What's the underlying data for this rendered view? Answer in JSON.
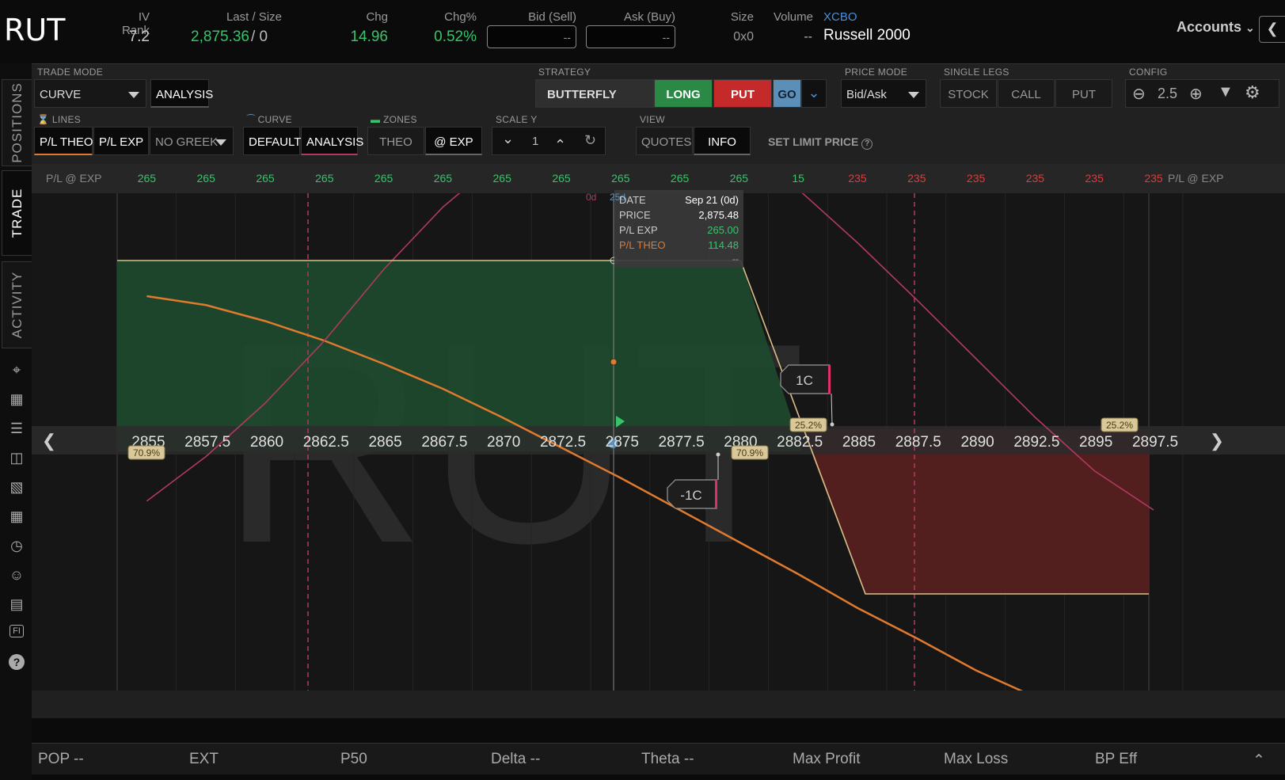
{
  "header": {
    "symbol": "RUT",
    "iv_rank_label": "IV Rank",
    "iv_rank": "7.2",
    "last_label": "Last / Size",
    "last": "2,875.36",
    "last_size": "/ 0",
    "chg_label": "Chg",
    "chg": "14.96",
    "chgpct_label": "Chg%",
    "chgpct": "0.52%",
    "bid_label": "Bid (Sell)",
    "bid": "--",
    "ask_label": "Ask (Buy)",
    "ask": "--",
    "size_label": "Size",
    "size": "0x0",
    "volume_label": "Volume",
    "volume": "--",
    "exchange": "XCBO",
    "name": "Russell 2000",
    "accounts": "Accounts"
  },
  "sidebar": {
    "tabs": [
      "POSITIONS",
      "TRADE",
      "ACTIVITY"
    ]
  },
  "toolbar": {
    "trade_mode_label": "TRADE MODE",
    "trade_mode": "CURVE",
    "analysis": "ANALYSIS",
    "strategy_label": "STRATEGY",
    "strategy": "BUTTERFLY",
    "long": "LONG",
    "put": "PUT",
    "go": "GO",
    "price_mode_label": "PRICE MODE",
    "price_mode": "Bid/Ask",
    "single_legs_label": "SINGLE LEGS",
    "legs": [
      "STOCK",
      "CALL",
      "PUT"
    ],
    "config_label": "CONFIG",
    "zoom": "2.5",
    "lines_label": "LINES",
    "lines": [
      "P/L THEO",
      "P/L EXP"
    ],
    "greek": "NO GREEK",
    "curve_label": "CURVE",
    "curve": [
      "DEFAULT",
      "ANALYSIS"
    ],
    "zones_label": "ZONES",
    "zones": [
      "THEO",
      "@ EXP"
    ],
    "scale_label": "SCALE Y",
    "scale": "1",
    "view_label": "VIEW",
    "view": [
      "QUOTES",
      "INFO"
    ],
    "limit": "SET LIMIT PRICE"
  },
  "pl_row": {
    "label": "P/L @ EXP",
    "values": [
      "265",
      "265",
      "265",
      "265",
      "265",
      "265",
      "265",
      "265",
      "265",
      "265",
      "265",
      "15",
      "235",
      "235",
      "235",
      "235",
      "235",
      "235"
    ],
    "colors": [
      "g",
      "g",
      "g",
      "g",
      "g",
      "g",
      "g",
      "g",
      "g",
      "g",
      "g",
      "g",
      "r",
      "r",
      "r",
      "r",
      "r",
      "r"
    ]
  },
  "chart_data": {
    "type": "line",
    "watermark": "RUT",
    "x_ticks": [
      "2855",
      "2857.5",
      "2860",
      "2862.5",
      "2865",
      "2867.5",
      "2870",
      "2872.5",
      "2875",
      "2877.5",
      "2880",
      "2882.5",
      "2885",
      "2887.5",
      "2890",
      "2892.5",
      "2895",
      "2897.5"
    ],
    "x": [
      2855,
      2857.5,
      2860,
      2862.5,
      2865,
      2867.5,
      2870,
      2872.5,
      2875,
      2877.5,
      2880,
      2882.5,
      2885,
      2887.5,
      2890,
      2892.5,
      2895,
      2897.5
    ],
    "series": [
      {
        "color": "#e07a2e",
        "values": [
          0.8,
          0.75,
          0.66,
          0.55,
          0.42,
          0.28,
          0.12,
          -0.05,
          -0.22,
          -0.4,
          -0.58,
          -0.76,
          -0.95,
          -1.12,
          -1.3,
          -1.45,
          -1.6,
          -1.72
        ]
      },
      {
        "color": "#b03a60",
        "values": [
          -0.35,
          -0.1,
          0.2,
          0.55,
          0.95,
          1.3,
          1.58,
          1.78,
          1.87,
          1.82,
          1.65,
          1.4,
          1.1,
          0.78,
          0.45,
          0.12,
          -0.18,
          -0.4
        ]
      },
      {
        "color": "#d9c08a",
        "values": [
          1,
          1,
          1,
          1,
          1,
          1,
          1,
          1,
          1,
          1,
          1,
          0.05,
          -1,
          -1,
          -1,
          -1,
          -1,
          -1
        ]
      }
    ],
    "pop_labels": [
      "70.9%",
      "70.9%",
      "25.2%",
      "25.2%"
    ],
    "legs": [
      "1C",
      "-1C"
    ],
    "cursor_tags": [
      "0d",
      "25d"
    ]
  },
  "tooltip": {
    "date_label": "DATE",
    "date": "Sep 21 (0d)",
    "price_label": "PRICE",
    "price": "2,875.48",
    "plexp_label": "P/L EXP",
    "plexp": "265.00",
    "pltheo_label": "P/L THEO",
    "pltheo": "114.48",
    "extra": "--"
  },
  "footer": {
    "items": [
      "POP --",
      "EXT",
      "P50",
      "Delta --",
      "Theta --",
      "Max Profit",
      "Max Loss",
      "BP Eff"
    ]
  },
  "colors": {
    "green": "#36c46a",
    "red": "#e23a3a",
    "profit_zone": "#1d4a2e",
    "loss_zone": "#5a1f1f"
  }
}
